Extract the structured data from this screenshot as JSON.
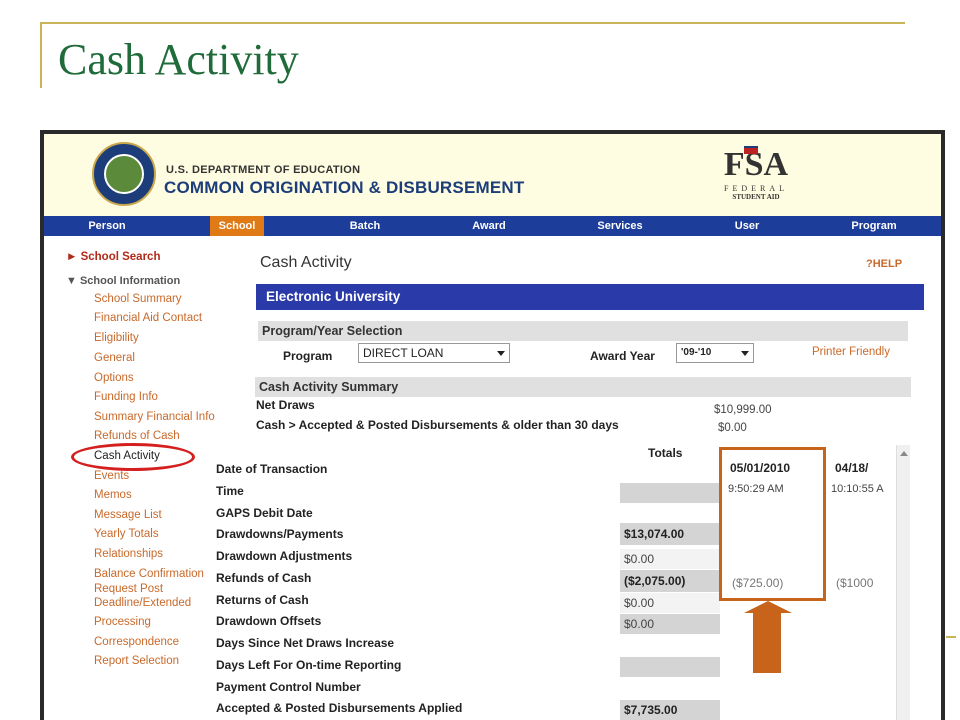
{
  "slide": {
    "title": "Cash Activity"
  },
  "header": {
    "dept": "U.S. DEPARTMENT OF EDUCATION",
    "system": "COMMON ORIGINATION & DISBURSEMENT",
    "fsa_mark": "FSA",
    "fsa_sub1": "FEDERAL",
    "fsa_sub2": "STUDENT AID"
  },
  "nav": [
    {
      "label": "Person"
    },
    {
      "label": "School",
      "active": true
    },
    {
      "label": "Batch"
    },
    {
      "label": "Award"
    },
    {
      "label": "Services"
    },
    {
      "label": "User"
    },
    {
      "label": "Program"
    }
  ],
  "sidebar": {
    "school_search": "► School Search",
    "school_information": "▼ School Information",
    "items": [
      "School Summary",
      "Financial Aid Contact",
      "Eligibility",
      "General",
      "Options",
      "Funding Info",
      "Summary Financial Info",
      "Refunds of Cash",
      "Cash Activity",
      "Events",
      "Memos",
      "Message List",
      "Yearly Totals",
      "Relationships",
      "Balance Confirmation",
      "Request Post",
      "Deadline/Extended",
      "Processing",
      "Correspondence",
      "Report Selection"
    ]
  },
  "page": {
    "heading": "Cash Activity",
    "help": "HELP",
    "school_name": "Electronic University",
    "program_year_heading": "Program/Year Selection",
    "program_label": "Program",
    "program_value": "DIRECT LOAN",
    "award_year_label": "Award Year",
    "award_year_value": "'09-'10",
    "printer_friendly": "Printer Friendly",
    "summary_heading": "Cash Activity Summary",
    "net_draws_label": "Net Draws",
    "net_draws_value": "$10,999.00",
    "cash_label": "Cash > Accepted & Posted Disbursements & older than 30 days",
    "cash_value": "$0.00"
  },
  "grid": {
    "totals_header": "Totals",
    "rows": [
      {
        "label": "Date of Transaction",
        "total": ""
      },
      {
        "label": "Time",
        "total": ""
      },
      {
        "label": "GAPS Debit Date",
        "total": ""
      },
      {
        "label": "Drawdowns/Payments",
        "total": "$13,074.00"
      },
      {
        "label": "Drawdown Adjustments",
        "total": "$0.00"
      },
      {
        "label": "Refunds of Cash",
        "total": "($2,075.00)"
      },
      {
        "label": "Returns of Cash",
        "total": "$0.00"
      },
      {
        "label": "Drawdown Offsets",
        "total": "$0.00"
      },
      {
        "label": "Days Since Net Draws Increase",
        "total": ""
      },
      {
        "label": "Days Left For On-time Reporting",
        "total": ""
      },
      {
        "label": "Payment Control Number",
        "total": ""
      },
      {
        "label": "Accepted & Posted Disbursements Applied",
        "total": "$7,735.00"
      }
    ],
    "columns": [
      {
        "date": "05/01/2010",
        "time": "9:50:29 AM",
        "refund": "($725.00)"
      },
      {
        "date": "04/18/",
        "time": "10:10:55 A",
        "refund": "($1000"
      }
    ]
  }
}
